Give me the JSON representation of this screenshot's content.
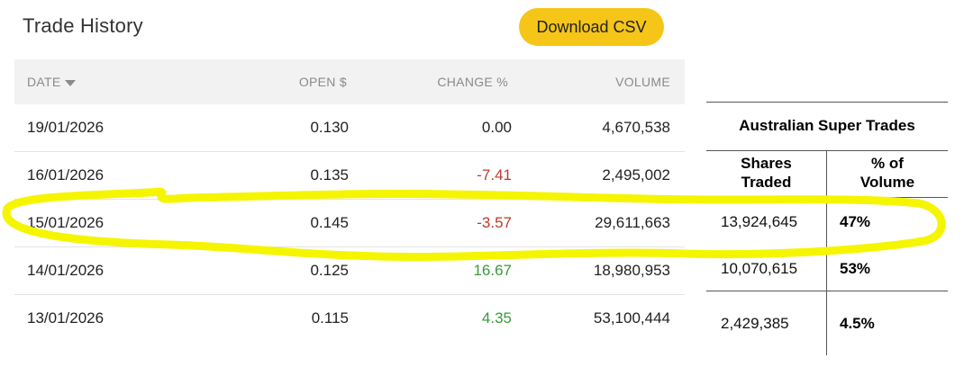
{
  "header": {
    "title": "Trade History",
    "download_label": "Download CSV"
  },
  "table": {
    "columns": {
      "date": "DATE",
      "open": "OPEN $",
      "change": "CHANGE %",
      "volume": "VOLUME"
    },
    "rows": [
      {
        "date": "19/01/2026",
        "open": "0.130",
        "change": "0.00",
        "volume": "4,670,538"
      },
      {
        "date": "16/01/2026",
        "open": "0.135",
        "change": "-7.41",
        "volume": "2,495,002"
      },
      {
        "date": "15/01/2026",
        "open": "0.145",
        "change": "-3.57",
        "volume": "29,611,663"
      },
      {
        "date": "14/01/2026",
        "open": "0.125",
        "change": "16.67",
        "volume": "18,980,953"
      },
      {
        "date": "13/01/2026",
        "open": "0.115",
        "change": "4.35",
        "volume": "53,100,444"
      }
    ]
  },
  "aus_super": {
    "title": "Australian Super Trades",
    "col1_line1": "Shares",
    "col1_line2": "Traded",
    "col2_line1": "% of",
    "col2_line2": "Volume",
    "rows": [
      {
        "shares": "13,924,645",
        "pct": "47%"
      },
      {
        "shares": "10,070,615",
        "pct": "53%"
      },
      {
        "shares": "2,429,385",
        "pct": "4.5%"
      }
    ]
  },
  "colors": {
    "button": "#f5c518",
    "negative": "#c0392b",
    "positive": "#3a9a3a",
    "highlight": "#f5f500"
  }
}
